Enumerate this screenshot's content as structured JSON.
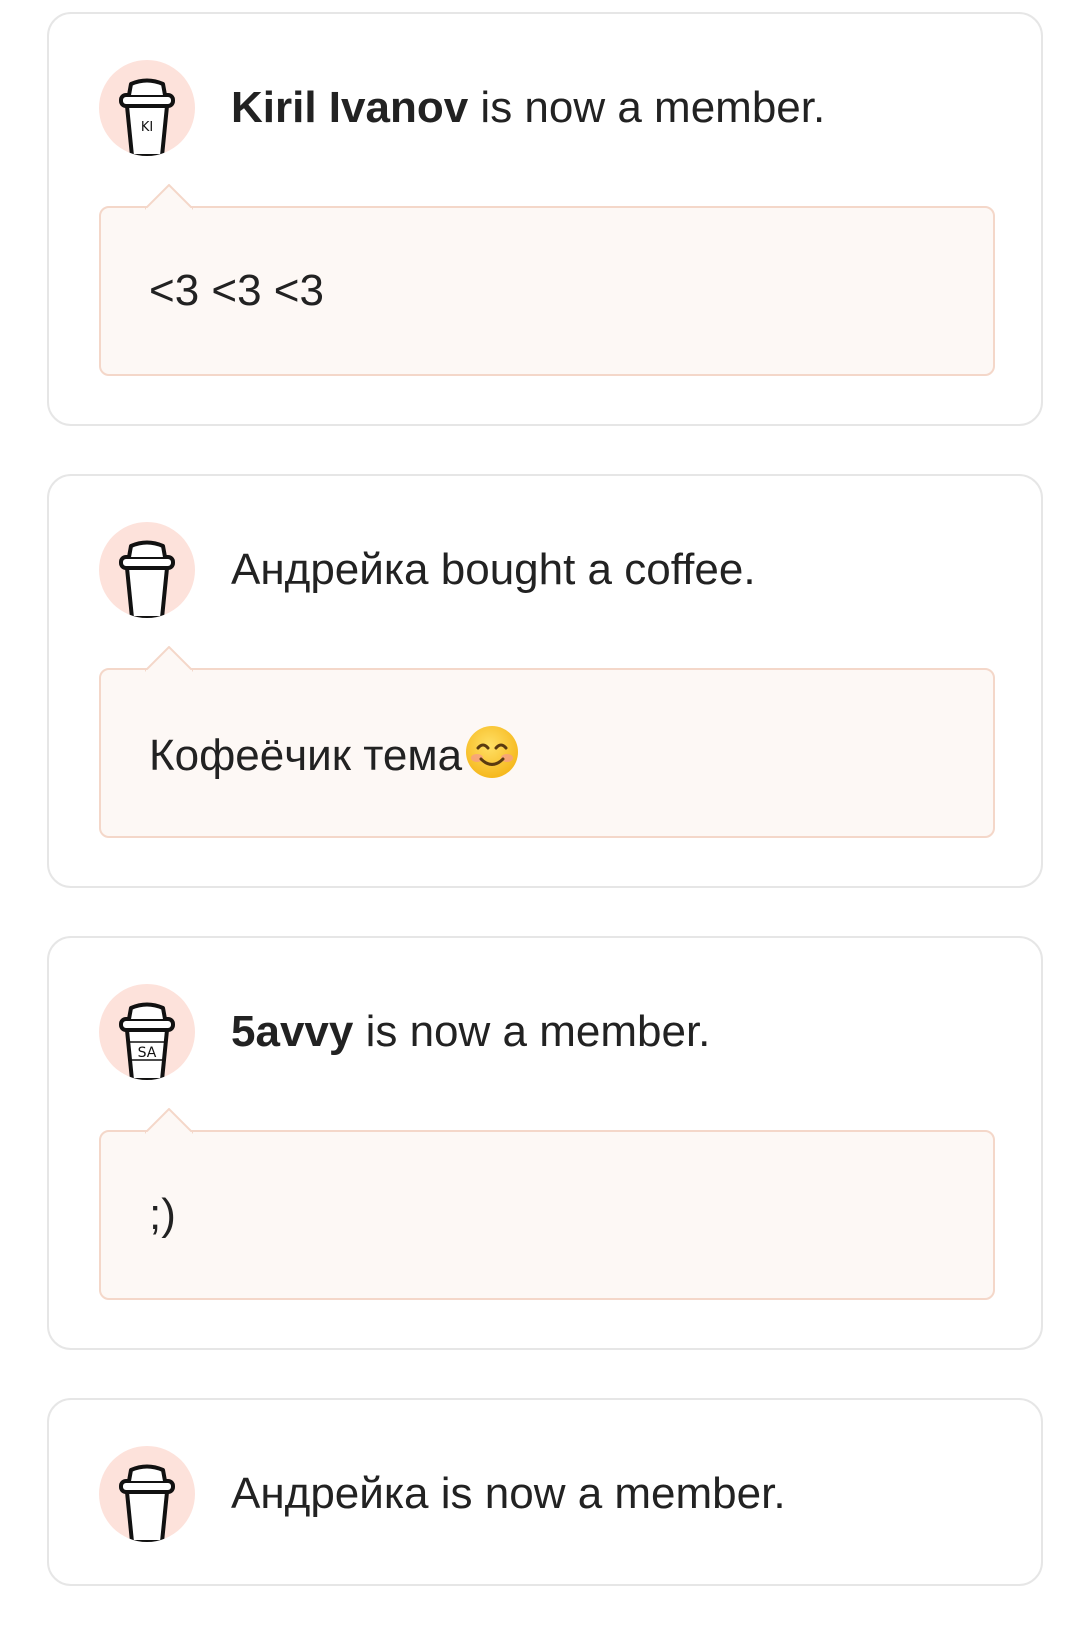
{
  "feed": {
    "items": [
      {
        "name": "Kiril Ivanov",
        "name_bold": true,
        "action": " is now a member.",
        "avatar_initials": "KI",
        "message": "<3 <3 <3"
      },
      {
        "name": "Андрейка",
        "name_bold": false,
        "action": " bought a coffee.",
        "avatar_initials": "",
        "message": "Кофеёчик тема",
        "message_emoji": "smiling-face-icon"
      },
      {
        "name": "5avvy",
        "name_bold": true,
        "action": " is now a member.",
        "avatar_initials": "SA",
        "message": ";)"
      },
      {
        "name": "Андрейка",
        "name_bold": false,
        "action": " is now a member.",
        "avatar_initials": ""
      }
    ]
  },
  "colors": {
    "avatar_bg": "#fde2db",
    "bubble_bg": "#fdf8f5",
    "bubble_border": "#f4d7c9",
    "card_border": "#e6e6e6",
    "text": "#222222"
  }
}
